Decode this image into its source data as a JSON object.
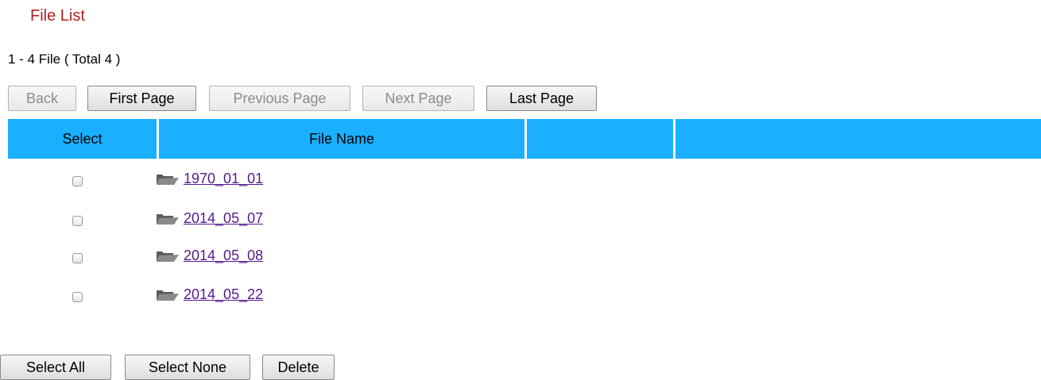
{
  "page": {
    "title": "File List",
    "summary": "1 - 4 File ( Total 4 )"
  },
  "pager": {
    "back": "Back",
    "first": "First Page",
    "previous": "Previous Page",
    "next": "Next Page",
    "last": "Last Page"
  },
  "table": {
    "headers": [
      "Select",
      "File Name",
      "",
      ""
    ],
    "rows": [
      {
        "name": "1970_01_01",
        "checked": false
      },
      {
        "name": "2014_05_07",
        "checked": false
      },
      {
        "name": "2014_05_08",
        "checked": false
      },
      {
        "name": "2014_05_22",
        "checked": false
      }
    ]
  },
  "actions": {
    "select_all": "Select All",
    "select_none": "Select None",
    "delete": "Delete"
  },
  "icons": {
    "row_icon": "folder-icon"
  },
  "colors": {
    "title": "#b22222",
    "header_bg": "#1ab0ff",
    "link": "#551a8b"
  }
}
